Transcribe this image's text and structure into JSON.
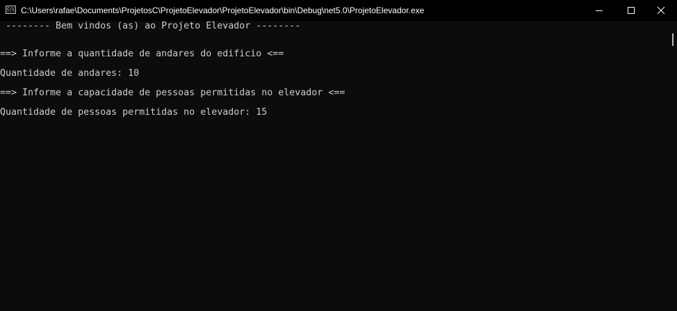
{
  "window": {
    "title": "C:\\Users\\rafae\\Documents\\ProjetosC\\ProjetoElevador\\ProjetoElevador\\bin\\Debug\\net5.0\\ProjetoElevador.exe",
    "icon_text": "C:\\",
    "controls": {
      "minimize_icon": "minimize-icon",
      "maximize_icon": "maximize-icon",
      "close_icon": "close-icon"
    }
  },
  "console": {
    "background_color": "#0c0c0c",
    "text_color": "#cccccc",
    "lines": [
      " -------- Bem vindos (as) ao Projeto Elevador --------",
      "==> Informe a quantidade de andares do edificio <==",
      "Quantidade de andares: 10",
      "==> Informe a capacidade de pessoas permitidas no elevador <==",
      "Quantidade de pessoas permitidas no elevador: 15"
    ]
  }
}
